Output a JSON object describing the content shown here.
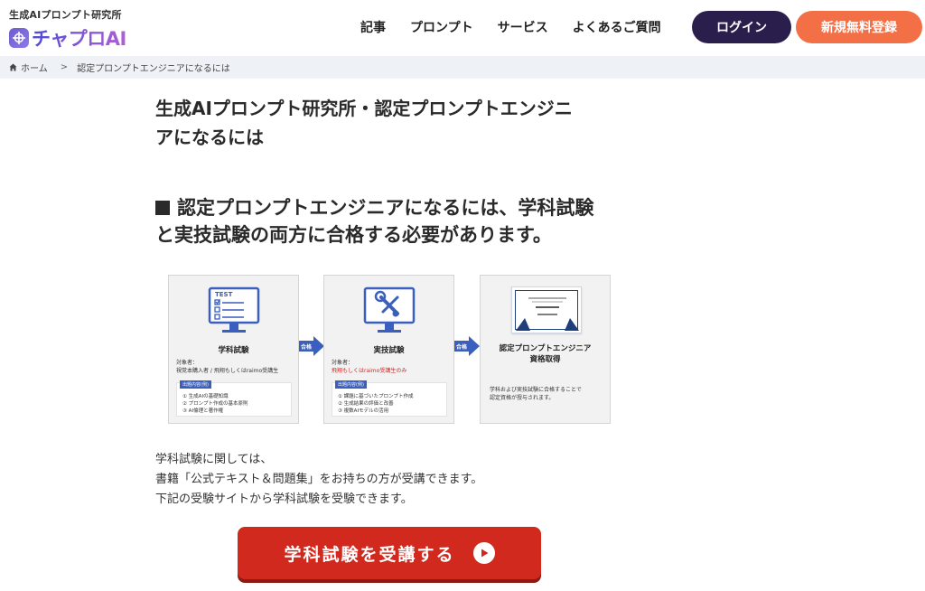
{
  "header": {
    "logo_tagline": "生成AIプロンプト研究所",
    "logo_name": "チャプロAI",
    "nav": [
      "記事",
      "プロンプト",
      "サービス",
      "よくあるご質問"
    ],
    "login_label": "ログイン",
    "register_label": "新規無料登録"
  },
  "breadcrumb": {
    "home": "ホーム",
    "separator": ">",
    "current": "認定プロンプトエンジニアになるには"
  },
  "page": {
    "title_line1": "生成AIプロンプト研究所・認定プロンプトエンジニ",
    "title_line2": "アになるには",
    "heading_line1": "認定プロンプトエンジニアになるには、学科試験",
    "heading_line2": "と実技試験の両方に合格する必要があります。"
  },
  "flow": {
    "cards": [
      {
        "icon": "test-monitor-icon",
        "title": "学科試験",
        "target_label": "対象者：",
        "target": "視覚本購入者 / 飛翔もしくはraimo受講生",
        "content_badge": "出題内容(例)",
        "items": [
          "① 生成AIの基礎知識",
          "② プロンプト作成の基本原則",
          "③ AI倫理と著作権"
        ]
      },
      {
        "icon": "tools-monitor-icon",
        "title": "実技試験",
        "target_label": "対象者：",
        "target": "飛翔もしくはraimo受講生のみ",
        "content_badge": "出題内容(例)",
        "items": [
          "① 課題に基づいたプロンプト作成",
          "② 生成結果の評価と改善",
          "③ 複数AIモデルの活用"
        ]
      },
      {
        "icon": "certificate-icon",
        "title_line1": "認定プロンプトエンジニア",
        "title_line2": "資格取得",
        "desc_line1": "学科および実技試験に合格することで",
        "desc_line2": "認定資格が授与されます。"
      }
    ],
    "arrow_label": "合格"
  },
  "body_lines": [
    "学科試験に関しては、",
    "書籍「公式テキスト＆問題集」をお持ちの方が受講できます。",
    "下記の受験サイトから学科試験を受験できます。"
  ],
  "cta": {
    "label": "学科試験を受講する",
    "icon": "play-circle-icon"
  },
  "colors": {
    "login_bg": "#2a1e4d",
    "register_bg": "#f36f46",
    "cta_bg": "#d2291e",
    "accent_blue": "#3a5fbf",
    "breadcrumb_bg": "#eef2f7"
  }
}
